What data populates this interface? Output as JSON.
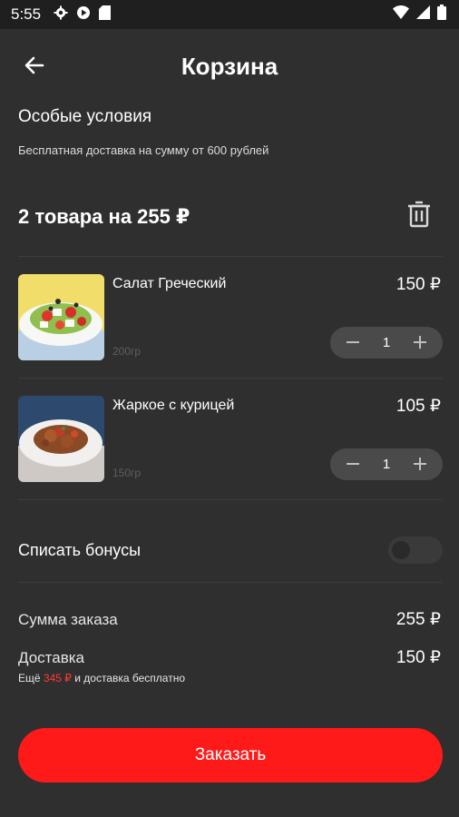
{
  "status_bar": {
    "time": "5:55"
  },
  "header": {
    "title": "Корзина"
  },
  "special": {
    "title": "Особые условия",
    "text": "Бесплатная доставка на сумму от 600 рублей"
  },
  "cart": {
    "summary": "2 товара на 255 ₽",
    "items": [
      {
        "name": "Салат Греческий",
        "weight": "200гр",
        "price": "150 ₽",
        "qty": "1"
      },
      {
        "name": "Жаркое с курицей",
        "weight": "150гр",
        "price": "105 ₽",
        "qty": "1"
      }
    ]
  },
  "bonus": {
    "label": "Списать бонусы",
    "enabled": false
  },
  "totals": {
    "order_label": "Сумма заказа",
    "order_value": "255 ₽",
    "delivery_label": "Доставка",
    "delivery_value": "150 ₽",
    "note_prefix": "Ещё ",
    "note_amount": "345 ₽",
    "note_suffix": " и доставка бесплатно"
  },
  "order_button": {
    "label": "Заказать"
  },
  "colors": {
    "background": "#2f2f2f",
    "accent": "#ff1a1a",
    "note_accent": "#ff3b30"
  },
  "icons": [
    "settings-icon",
    "play-protect-icon",
    "sd-card-icon",
    "wifi-icon",
    "signal-icon",
    "battery-icon",
    "back-arrow-icon",
    "trash-icon",
    "minus-icon",
    "plus-icon"
  ]
}
